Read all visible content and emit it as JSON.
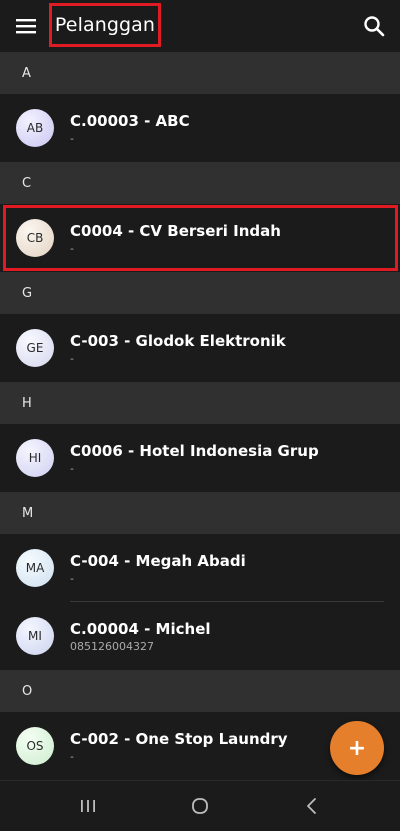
{
  "appbar": {
    "title": "Pelanggan",
    "menu_icon": "hamburger-menu-icon",
    "search_icon": "search-icon"
  },
  "sections": [
    {
      "letter": "A",
      "items": [
        {
          "initials": "AB",
          "title": "C.00003 - ABC",
          "subtitle": "-",
          "avatar_color": "#c9c6f0"
        }
      ]
    },
    {
      "letter": "C",
      "items": [
        {
          "initials": "CB",
          "title": "C0004 - CV Berseri Indah",
          "subtitle": "-",
          "avatar_color": "#eadfd2"
        }
      ]
    },
    {
      "letter": "G",
      "items": [
        {
          "initials": "GE",
          "title": "C-003 - Glodok Elektronik",
          "subtitle": "-",
          "avatar_color": "#dde0f0"
        }
      ]
    },
    {
      "letter": "H",
      "items": [
        {
          "initials": "HI",
          "title": "C0006 - Hotel Indonesia Grup",
          "subtitle": "-",
          "avatar_color": "#d8d8f4"
        }
      ]
    },
    {
      "letter": "M",
      "items": [
        {
          "initials": "MA",
          "title": "C-004 - Megah Abadi",
          "subtitle": "-",
          "avatar_color": "#d6e6f2"
        },
        {
          "initials": "MI",
          "title": "C.00004 - Michel",
          "subtitle": "085126004327",
          "avatar_color": "#d4daf2"
        }
      ]
    },
    {
      "letter": "O",
      "items": [
        {
          "initials": "OS",
          "title": "C-002 - One Stop Laundry",
          "subtitle": "-",
          "avatar_color": "#d9f0d9"
        }
      ]
    }
  ],
  "fab": {
    "icon": "plus-icon",
    "label": "+",
    "color": "#e57f2b"
  },
  "navbar": {
    "recents_icon": "recent-apps-icon",
    "home_icon": "home-icon",
    "back_icon": "back-icon"
  },
  "highlight_color": "#e01b24"
}
